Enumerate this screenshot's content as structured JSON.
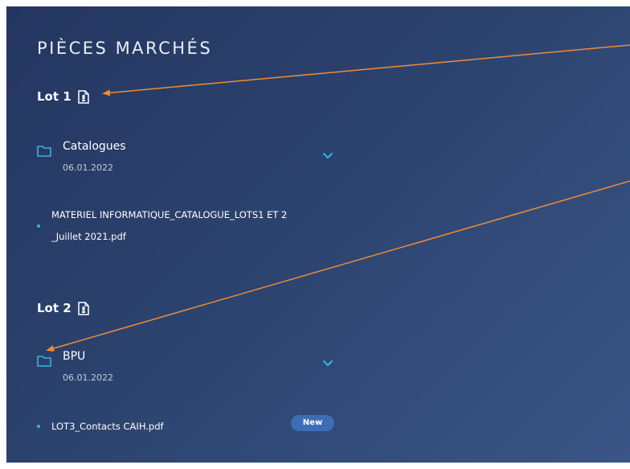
{
  "title": "PIÈCES MARCHÉS",
  "lots": [
    {
      "label": "Lot 1",
      "icon": "document-icon",
      "folder": {
        "name": "Catalogues",
        "date": "06.01.2022",
        "icon": "folder-icon",
        "expanded": false
      },
      "files": [
        {
          "name_line1": "MATERIEL INFORMATIQUE_CATALOGUE_LOTS1 ET 2",
          "name_line2": "_Juillet 2021.pdf",
          "badge": ""
        }
      ]
    },
    {
      "label": "Lot 2",
      "icon": "document-icon",
      "folder": {
        "name": "BPU",
        "date": "06.01.2022",
        "icon": "folder-icon",
        "expanded": false
      },
      "files": [
        {
          "name_line1": "LOT3_Contacts CAIH.pdf",
          "name_line2": "",
          "badge": "New"
        }
      ]
    }
  ],
  "colors": {
    "accent": "#38b3e0",
    "annotation_arrow": "#f08b3a",
    "badge": "#3d6db7",
    "panel_bg": "#2d4470"
  },
  "annotations": [
    "arrow-to-document-icon",
    "arrow-to-folder-icon"
  ]
}
